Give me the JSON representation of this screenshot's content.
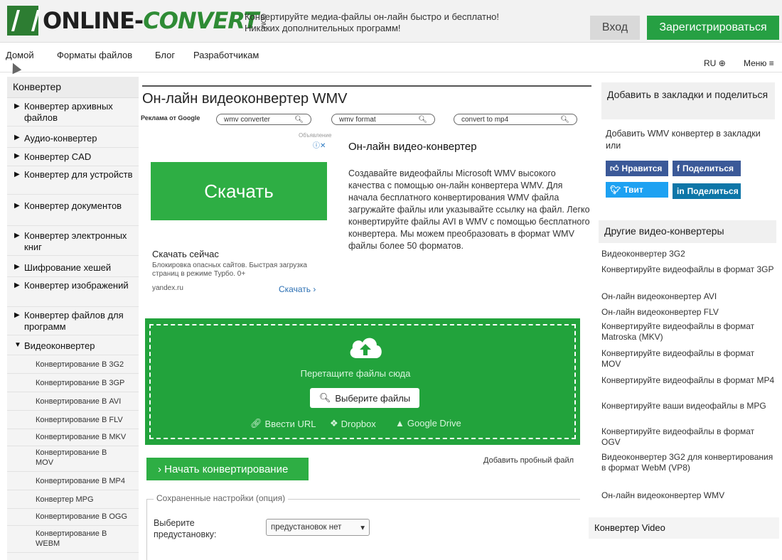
{
  "header": {
    "logo_part1": "ONLINE-",
    "logo_part2": "CONVERT",
    "logo_com": "COM",
    "tagline_line1": "Конвертируйте медиа-файлы он-лайн быстро и бесплатно!",
    "tagline_line2": "Никаких дополнительных программ!",
    "login_label": "Вход",
    "register_label": "Зарегистрироваться"
  },
  "nav": {
    "items": [
      "Домой",
      "Форматы файлов",
      "Блог",
      "Разработчикам"
    ],
    "lang": "RU",
    "menu": "Меню"
  },
  "sidebar": {
    "title": "Конвертер",
    "items": [
      "Конвертер архивных файлов",
      "Аудио-конвертер",
      "Конвертер CAD",
      "Конвертер для устройств",
      "Конвертер документов",
      "Конвертер электронных книг",
      "Шифрование хешей",
      "Конвертер изображений",
      "Конвертер файлов для программ",
      "Видеоконвертер"
    ],
    "subitems": [
      "Конвертирование В 3G2",
      "Конвертирование В 3GP",
      "Конвертирование В AVI",
      "Конвертирование В FLV",
      "Конвертирование В MKV",
      "Конвертирование В MOV",
      "Конвертирование В MP4",
      "Конвертер MPG",
      "Конвертирование В OGG",
      "Конвертирование В WEBM"
    ]
  },
  "main": {
    "title": "Он-лайн видеоконвертер WMV",
    "ads_label": "Реклама от Google",
    "ad_searches": [
      "wmv converter",
      "wmv format",
      "convert to mp4"
    ],
    "ad_small_label": "Объявление",
    "ad_button": "Скачать",
    "ad_title": "Скачать сейчас",
    "ad_desc": "Блокировка опасных сайтов. Быстрая загрузка страниц в режиме Турбо. 0+",
    "ad_domain": "yandex.ru",
    "ad_link": "Скачать",
    "desc_title": "Он-лайн видео-конвертер",
    "desc_text": "Создавайте видеофайлы Microsoft WMV высокого качества с помощью он-лайн конвертера WMV. Для начала бесплатного конвертирования WMV файла загружайте файлы или указывайте ссылку на файл. Легко конвертируйте файлы AVI в WMV с помощью бесплатного конвертера. Мы можем преобразовать в формат WMV файлы более 50 форматов.",
    "upload": {
      "drop_text": "Перетащите файлы сюда",
      "choose_label": "Выберите файлы",
      "url_label": "Ввести URL",
      "dropbox_label": "Dropbox",
      "gdrive_label": "Google Drive"
    },
    "start_label": "Начать конвертирование",
    "sample_link": "Добавить пробный файл",
    "settings_legend": "Сохраненные настройки (опция)",
    "preset_label": "Выберите предустановку:",
    "preset_value": "предустановок нет"
  },
  "right": {
    "bookmark_title": "Добавить в закладки и поделиться",
    "bookmark_text": "Добавить WMV конвертер в закладки или",
    "like": "Нравится",
    "fb_share": "Поделиться",
    "tweet": "Твит",
    "in_share": "Поделиться",
    "other_title": "Другие видео-конвертеры",
    "links": [
      "Видеоконвертер 3G2",
      "Конвертируйте видеофайлы в формат 3GP",
      "Он-лайн видеоконвертер AVI",
      "Он-лайн видеоконвертер FLV",
      "Конвертируйте видеофайлы в формат Matroska (MKV)",
      "Конвертируйте видеофайлы в формат MOV",
      "Конвертируйте видеофайлы в формат MP4",
      "Конвертируйте ваши видеофайлы в MPG",
      "Конвертируйте видеофайлы в формат OGV",
      "Видеоконвертер 3G2 для конвертирования в формат WebM (VP8)",
      "Он-лайн видеоконвертер WMV"
    ],
    "video_title": "Конвертер Video"
  },
  "colors": {
    "green": "#22a33c",
    "green_light": "#2eae44",
    "register": "#26a043"
  }
}
